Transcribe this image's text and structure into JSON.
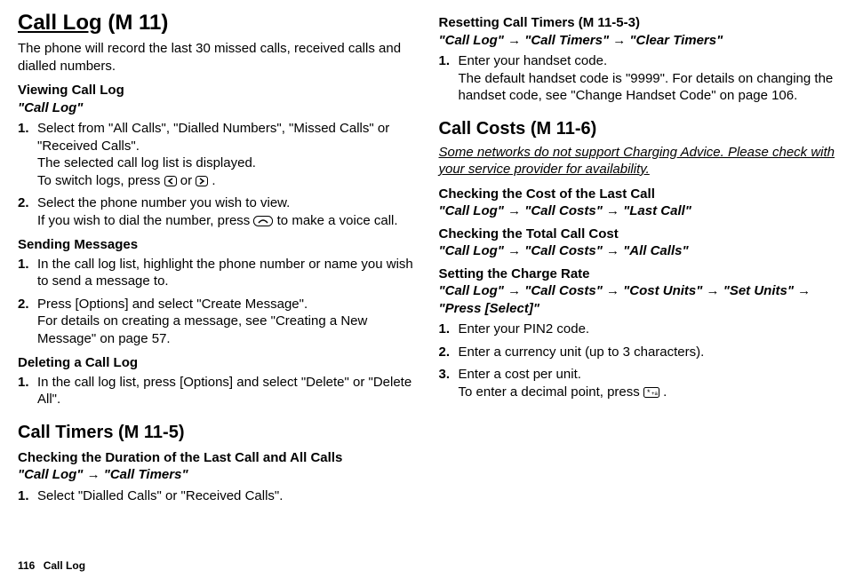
{
  "left": {
    "title_underline": "Call Log",
    "title_code": " (M 11)",
    "intro": "The phone will record the last 30 missed calls, received calls and dialled numbers.",
    "viewing_heading": "Viewing Call Log",
    "viewing_path": "\"Call Log\"",
    "viewing_steps": [
      {
        "main": "Select from \"All Calls\", \"Dialled Numbers\", \"Missed Calls\" or \"Received Calls\".",
        "sub1": "The selected call log list is displayed.",
        "sub2_pre": "To switch logs, press ",
        "sub2_mid": " or ",
        "sub2_post": "."
      },
      {
        "main": "Select the phone number you wish to view.",
        "sub_pre": "If you wish to dial the number, press ",
        "sub_post": " to make a voice call."
      }
    ],
    "sending_heading": "Sending Messages",
    "sending_steps": [
      {
        "main": "In the call log list, highlight the phone number or name you wish to send a message to."
      },
      {
        "main": "Press [Options] and select \"Create Message\".",
        "sub": "For details on creating a message, see \"Creating a New Message\" on page 57."
      }
    ],
    "deleting_heading": "Deleting a Call Log",
    "deleting_steps": [
      {
        "main": "In the call log list, press [Options] and select \"Delete\" or \"Delete All\"."
      }
    ],
    "timers_title": "Call Timers (M 11-5)",
    "timers_subheading": "Checking the Duration of the Last Call and All Calls",
    "timers_path": "\"Call Log\" → \"Call Timers\"",
    "timers_steps": [
      {
        "main": "Select \"Dialled Calls\" or \"Received Calls\"."
      }
    ]
  },
  "right": {
    "resetting_heading": "Resetting Call Timers (M 11-5-3)",
    "resetting_path": "\"Call Log\" → \"Call Timers\" → \"Clear Timers\"",
    "resetting_steps": [
      {
        "main": "Enter your handset code.",
        "sub": "The default handset code is \"9999\". For details on changing the handset code, see \"Change Handset Code\" on page 106."
      }
    ],
    "costs_title": "Call Costs (M 11-6)",
    "costs_note": "Some networks do not support Charging Advice. Please check with your service provider for availability.",
    "check_last_heading": "Checking the Cost of the Last Call",
    "check_last_path": "\"Call Log\" → \"Call Costs\" → \"Last Call\"",
    "check_total_heading": "Checking the Total Call Cost",
    "check_total_path": "\"Call Log\" → \"Call Costs\" → \"All Calls\"",
    "set_rate_heading": "Setting the Charge Rate",
    "set_rate_path": "\"Call Log\" → \"Call Costs\" → \"Cost Units\" →  \"Set Units\" → \"Press [Select]\"",
    "set_rate_steps": [
      {
        "main": "Enter your PIN2 code."
      },
      {
        "main": "Enter a currency unit (up to 3 characters)."
      },
      {
        "main": "Enter a cost per unit.",
        "sub_pre": "To enter a decimal point, press ",
        "sub_post": "."
      }
    ]
  },
  "footer": {
    "page": "116",
    "title": "Call Log"
  }
}
